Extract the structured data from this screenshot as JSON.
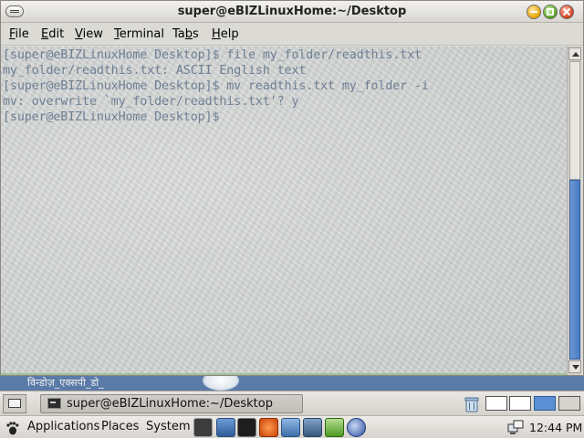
{
  "window": {
    "title": "super@eBIZLinuxHome:~/Desktop"
  },
  "menubar": {
    "items": [
      {
        "label": "File",
        "mnemonic": "F",
        "rest": "ile"
      },
      {
        "label": "Edit",
        "mnemonic": "E",
        "rest": "dit"
      },
      {
        "label": "View",
        "mnemonic": "V",
        "rest": "iew"
      },
      {
        "label": "Terminal",
        "mnemonic": "T",
        "rest": "erminal"
      },
      {
        "label": "Tabs",
        "pre": "Ta",
        "mnemonic": "b",
        "rest": "s"
      },
      {
        "label": "Help",
        "mnemonic": "H",
        "rest": "elp"
      }
    ]
  },
  "terminal": {
    "lines": [
      "[super@eBIZLinuxHome Desktop]$ file my_folder/readthis.txt",
      "my_folder/readthis.txt: ASCII English text",
      "[super@eBIZLinuxHome Desktop]$ mv readthis.txt my_folder -i",
      "mv: overwrite `my_folder/readthis.txt'? y",
      "[super@eBIZLinuxHome Desktop]$"
    ],
    "text_color": "#6e7f93"
  },
  "scrollbar": {
    "position_fraction": 1.0
  },
  "desktop": {
    "wallpaper_text": "विन्डोज़_एक्सपी_डो_"
  },
  "taskbar": {
    "task_label": "super@eBIZLinuxHome:~/Desktop",
    "workspaces": 4,
    "active_workspace": 3
  },
  "panel": {
    "menus": [
      "Applications",
      "Places",
      "System"
    ],
    "launchers": [
      "terminal-launcher",
      "display-launcher",
      "console-launcher",
      "office-launcher",
      "presentation-launcher",
      "spreadsheet-launcher",
      "calc-launcher",
      "browser-launcher"
    ],
    "clock": "12:44 PM"
  },
  "colors": {
    "accent": "#4a7cc4",
    "panel": "#dcdad5"
  }
}
